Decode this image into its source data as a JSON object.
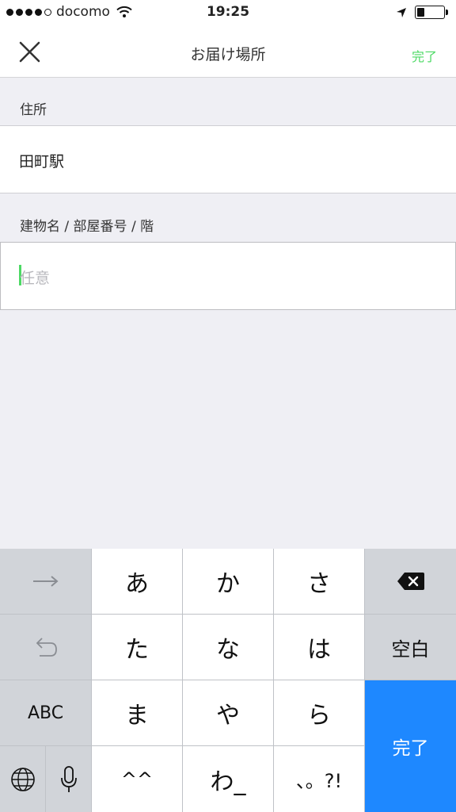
{
  "status_bar": {
    "carrier": "docomo",
    "time": "19:25",
    "battery_level": 0.3
  },
  "nav": {
    "title": "お届け場所",
    "done_label": "完了"
  },
  "form": {
    "address_label": "住所",
    "address_value": "田町駅",
    "building_label": "建物名 / 部屋番号 / 階",
    "building_placeholder": "任意"
  },
  "keyboard": {
    "next_symbol": "→",
    "undo_symbol": "↺",
    "abc_label": "ABC",
    "keys": [
      "あ",
      "か",
      "さ",
      "た",
      "な",
      "は",
      "ま",
      "や",
      "ら",
      "^^",
      "わ_",
      "、。?!"
    ],
    "space_label": "空白",
    "done_label": "完了"
  },
  "colors": {
    "accent": "#4cd964",
    "keyboard_done": "#1e88ff",
    "background": "#efeff4"
  },
  "icons": [
    "signal-dots-icon",
    "wifi-icon",
    "location-arrow-icon",
    "battery-icon",
    "close-icon",
    "backspace-icon",
    "globe-icon",
    "microphone-icon"
  ]
}
